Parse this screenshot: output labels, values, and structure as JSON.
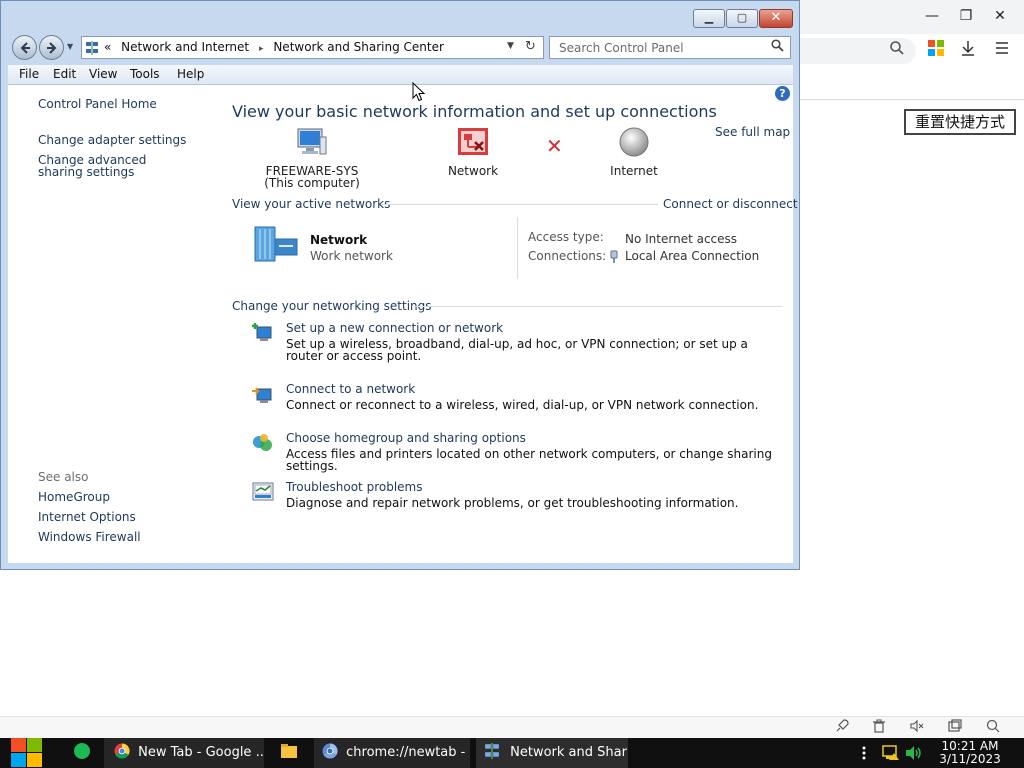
{
  "background_browser": {
    "reset_button_label": "重置快捷方式",
    "window_controls": {
      "minimize": "—",
      "restore": "❐",
      "close": "✕"
    }
  },
  "window": {
    "controls": {
      "minimize": "▁",
      "maximize": "▢",
      "close": "✕"
    },
    "address": {
      "chevron": "«",
      "segments": [
        "Network and Internet",
        "Network and Sharing Center"
      ],
      "separator": "▸"
    },
    "search": {
      "placeholder": "Search Control Panel"
    },
    "menu": [
      "File",
      "Edit",
      "View",
      "Tools",
      "Help"
    ]
  },
  "sidebar": {
    "home": "Control Panel Home",
    "links": [
      "Change adapter settings",
      "Change advanced sharing settings"
    ],
    "see_also_heading": "See also",
    "see_also": [
      "HomeGroup",
      "Internet Options",
      "Windows Firewall"
    ]
  },
  "main": {
    "title": "View your basic network information and set up connections",
    "see_full_map": "See full map",
    "map": {
      "computer": {
        "name": "FREEWARE-SYS",
        "sub": "(This computer)"
      },
      "network": "Network",
      "internet": "Internet"
    },
    "active_networks": {
      "heading": "View your active networks",
      "connect_link": "Connect or disconnect",
      "name": "Network",
      "type": "Work network",
      "access_type_label": "Access type:",
      "access_type_value": "No Internet access",
      "connections_label": "Connections:",
      "connections_value": "Local Area Connection"
    },
    "settings": {
      "heading": "Change your networking settings",
      "tasks": [
        {
          "title": "Set up a new connection or network",
          "desc": "Set up a wireless, broadband, dial-up, ad hoc, or VPN connection; or set up a router or access point."
        },
        {
          "title": "Connect to a network",
          "desc": "Connect or reconnect to a wireless, wired, dial-up, or VPN network connection."
        },
        {
          "title": "Choose homegroup and sharing options",
          "desc": "Access files and printers located on other network computers, or change sharing settings."
        },
        {
          "title": "Troubleshoot problems",
          "desc": "Diagnose and repair network problems, or get troubleshooting information."
        }
      ]
    }
  },
  "taskbar": {
    "items": [
      {
        "label": "New Tab - Google ..."
      },
      {
        "label": "chrome://newtab - ..."
      },
      {
        "label": "Network and Sharin..."
      }
    ],
    "clock": {
      "time": "10:21 AM",
      "date": "3/11/2023"
    }
  },
  "colors": {
    "link": "#1e395b",
    "window_frame": "#c6d9ef",
    "taskbar": "#101010"
  }
}
